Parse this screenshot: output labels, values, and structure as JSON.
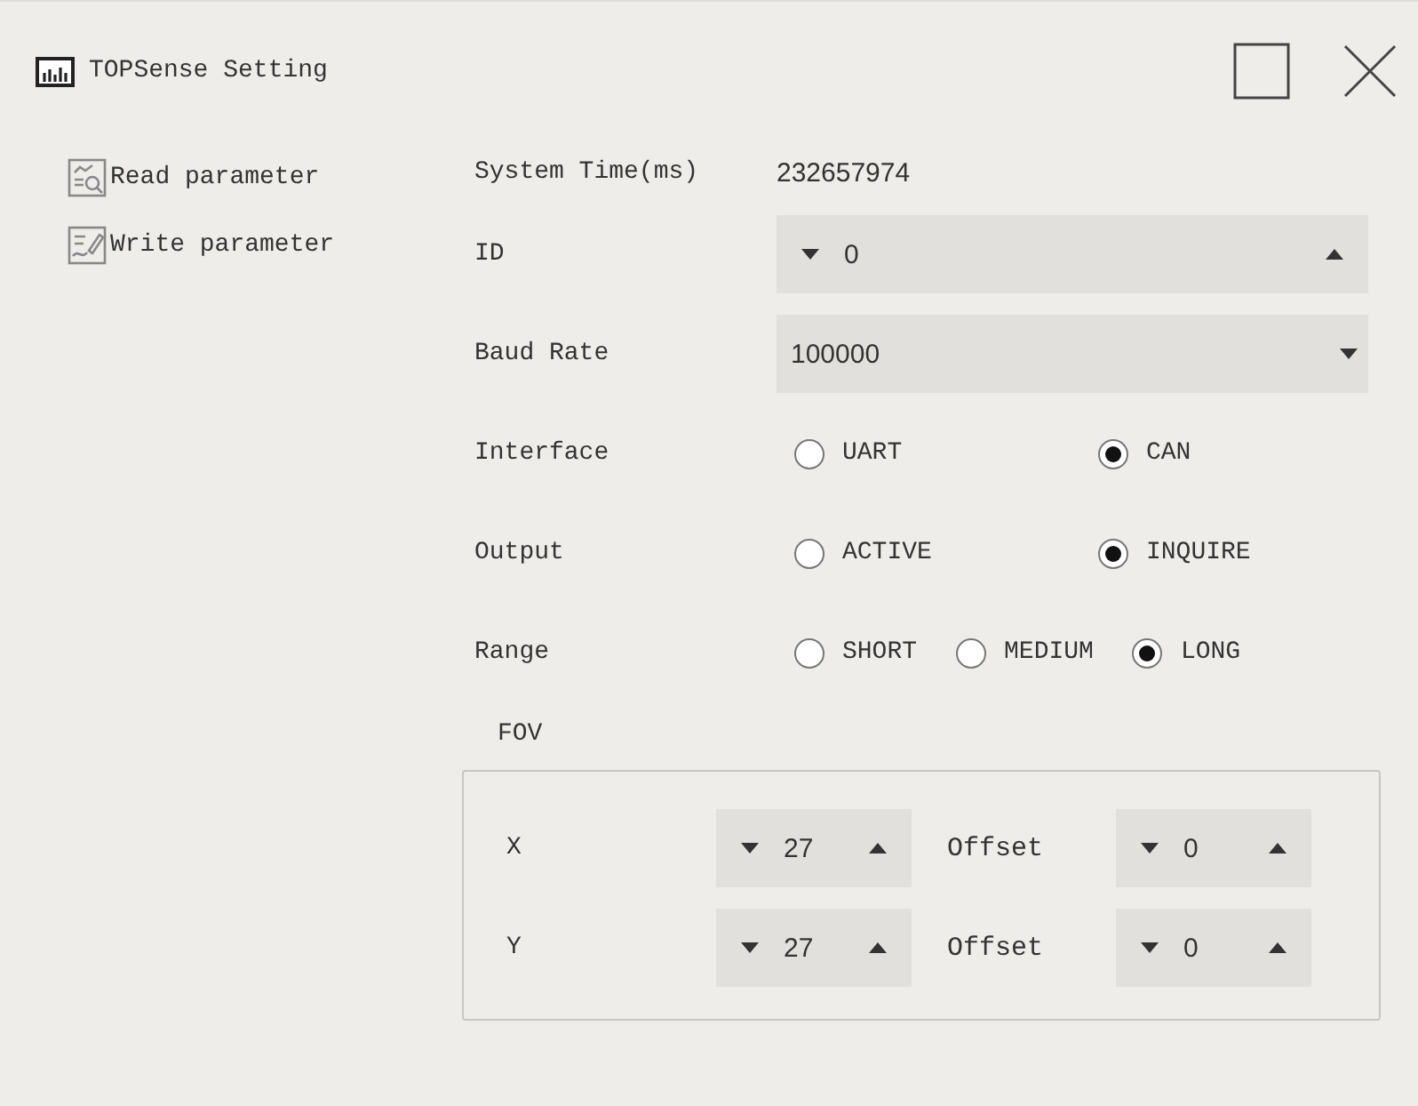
{
  "window": {
    "title": "TOPSense Setting"
  },
  "sidebar": {
    "items": [
      {
        "label": "Read parameter"
      },
      {
        "label": "Write parameter"
      }
    ]
  },
  "form": {
    "fields": [
      {
        "kind": "readout",
        "label": "System Time(ms)",
        "value": "232657974"
      },
      {
        "kind": "spinbox",
        "label": "ID",
        "value": "0"
      },
      {
        "kind": "dropdown",
        "label": "Baud Rate",
        "value": "100000"
      },
      {
        "kind": "radio",
        "label": "Interface",
        "options": [
          {
            "label": "UART",
            "selected": false
          },
          {
            "label": "CAN",
            "selected": true
          }
        ]
      },
      {
        "kind": "radio",
        "label": "Output",
        "options": [
          {
            "label": "ACTIVE",
            "selected": false
          },
          {
            "label": "INQUIRE",
            "selected": true
          }
        ]
      },
      {
        "kind": "radio",
        "label": "Range",
        "options": [
          {
            "label": "SHORT",
            "selected": false
          },
          {
            "label": "MEDIUM",
            "selected": false
          },
          {
            "label": "LONG",
            "selected": true
          }
        ]
      }
    ]
  },
  "fov": {
    "title": "FOV",
    "rows": [
      {
        "label": "X",
        "value": "27",
        "offset_label": "Offset",
        "offset_value": "0"
      },
      {
        "label": "Y",
        "value": "27",
        "offset_label": "Offset",
        "offset_value": "0"
      }
    ]
  }
}
